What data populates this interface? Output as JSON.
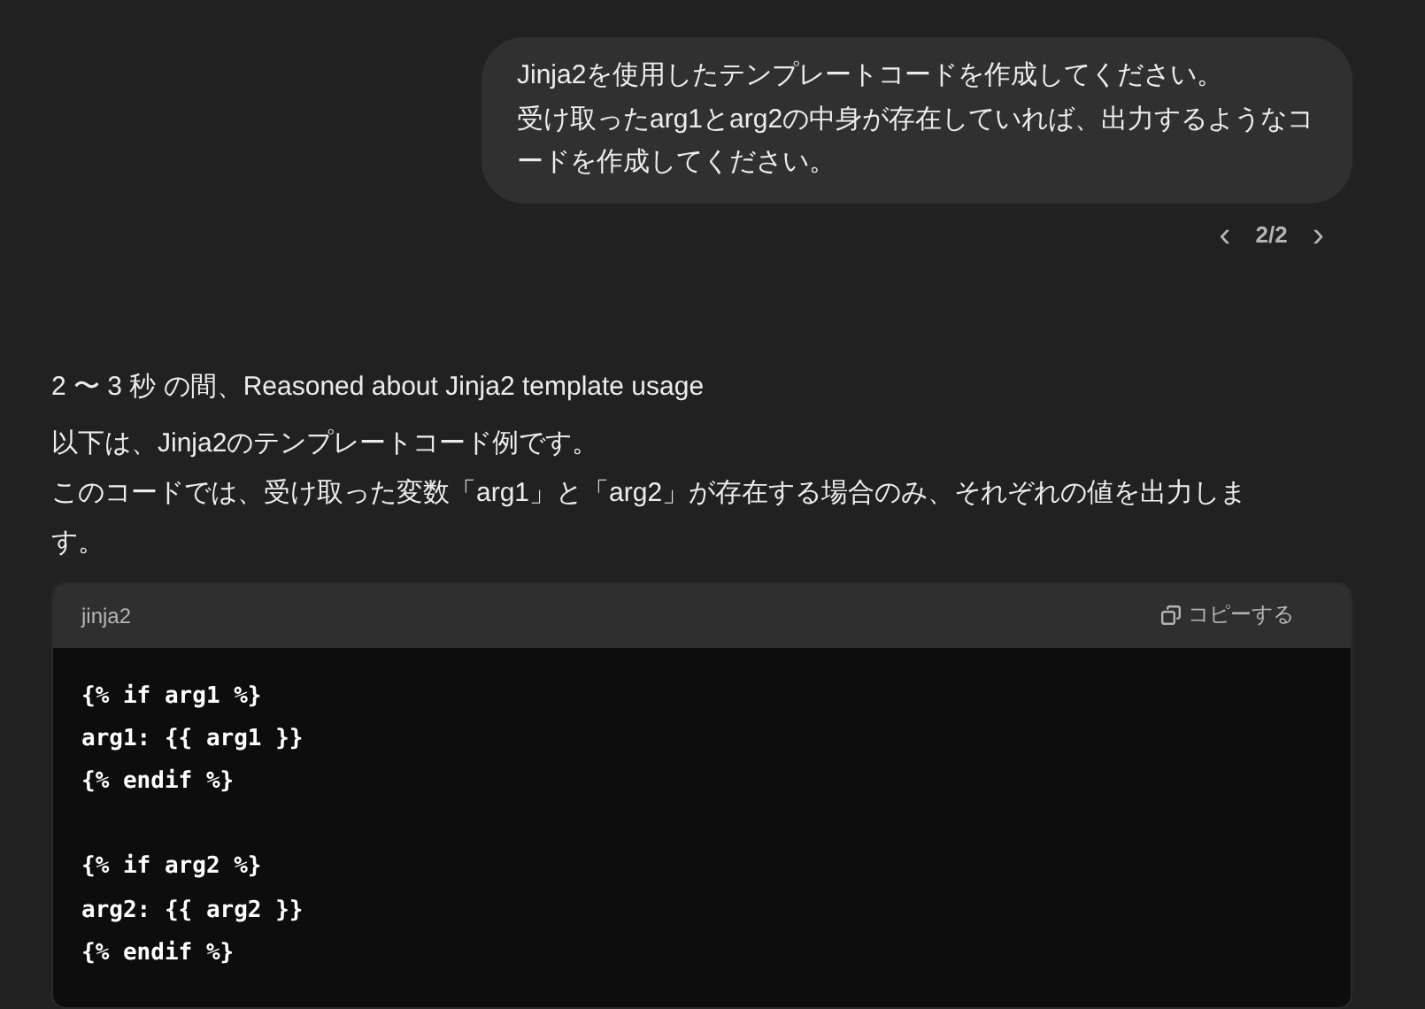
{
  "user_message": {
    "paragraphs": [
      "Jinja2を使用したテンプレートコードを作成してください。",
      "受け取ったarg1とarg2の中身が存在していれば、出力するようなコードを作成してください。"
    ],
    "pager": {
      "prev": "‹",
      "label": "2/2",
      "next": "›"
    }
  },
  "assistant": {
    "reasoning": "2 〜 3 秒 の間、Reasoned about Jinja2 template usage",
    "paragraphs": [
      "以下は、Jinja2のテンプレートコード例です。",
      "このコードでは、受け取った変数「arg1」と「arg2」が存在する場合のみ、それぞれの値を出力します。"
    ],
    "code_block": {
      "language": "jinja2",
      "copy_label": "コピーする",
      "groups": [
        [
          "{% if arg1 %}",
          "arg1: {{ arg1 }}",
          "{% endif %}"
        ],
        [
          "{% if arg2 %}",
          "arg2: {{ arg2 }}",
          "{% endif %}"
        ]
      ]
    }
  }
}
